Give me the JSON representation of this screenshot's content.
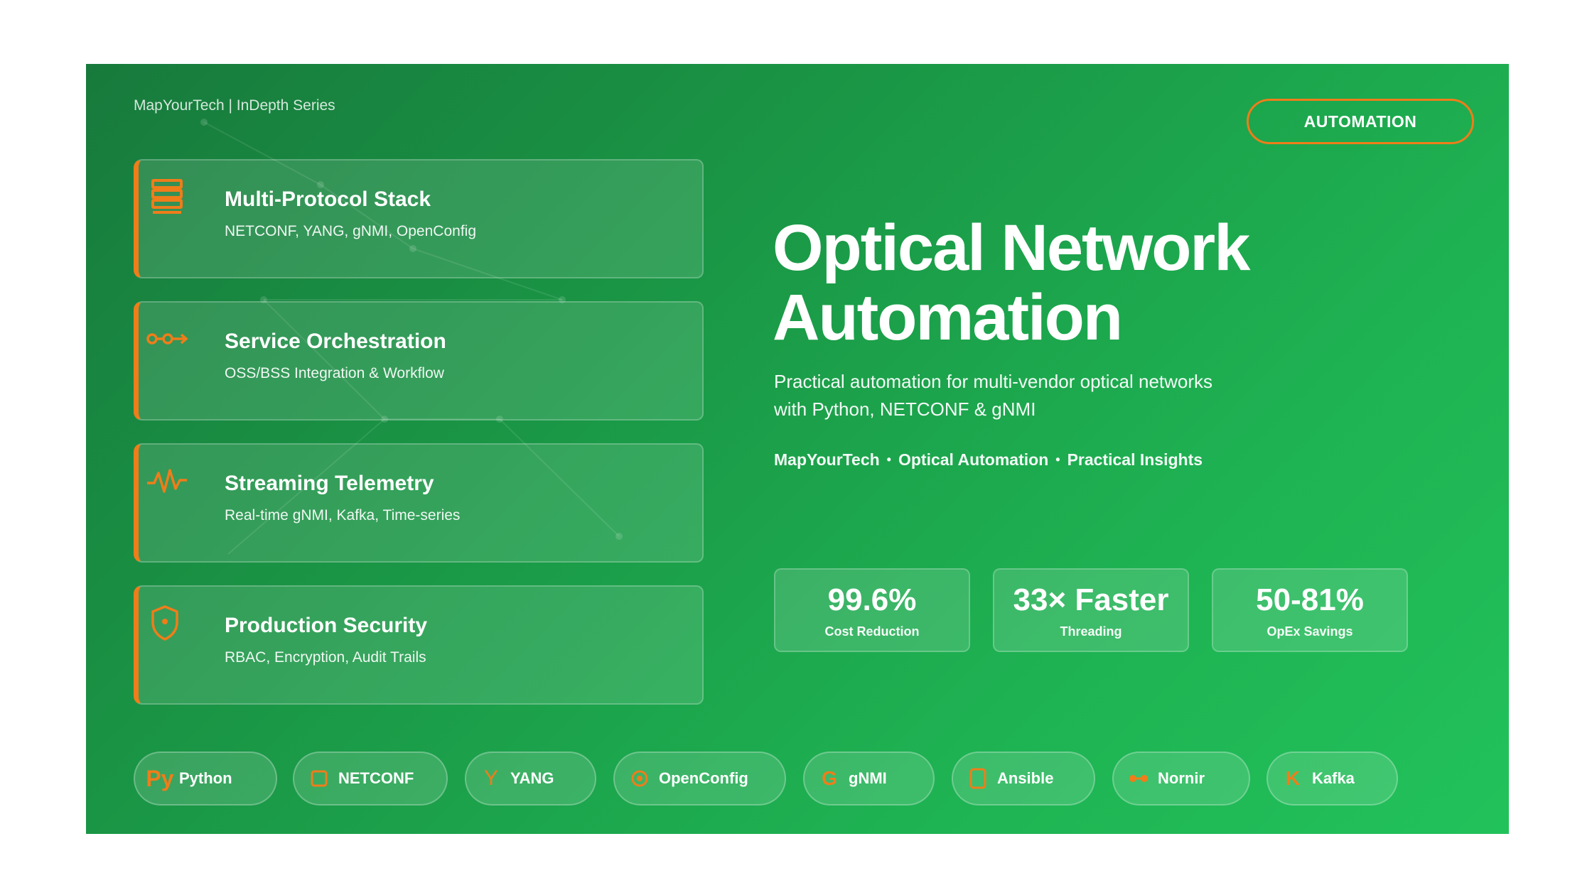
{
  "brand_top": "MapYourTech | InDepth Series",
  "badge": "AUTOMATION",
  "accent_color": "#ef7d1a",
  "background_gradient": [
    "#177a3c",
    "#22c25b"
  ],
  "cards": [
    {
      "title": "Multi-Protocol Stack",
      "subtitle": "NETCONF, YANG, gNMI, OpenConfig",
      "icon": "stack-icon"
    },
    {
      "title": "Service Orchestration",
      "subtitle": "OSS/BSS Integration & Workflow",
      "icon": "workflow-icon"
    },
    {
      "title": "Streaming Telemetry",
      "subtitle": "Real-time gNMI, Kafka, Time-series",
      "icon": "pulse-icon"
    },
    {
      "title": "Production Security",
      "subtitle": "RBAC, Encryption, Audit Trails",
      "icon": "shield-icon"
    }
  ],
  "hero": {
    "title_line1": "Optical Network",
    "title_line2": "Automation",
    "subtitle": "Practical automation for multi-vendor optical networks with Python, NETCONF & gNMI",
    "tagline": [
      "MapYourTech",
      "Optical Automation",
      "Practical Insights"
    ],
    "tagline_separator": "•"
  },
  "stats": [
    {
      "value": "99.6%",
      "label": "Cost Reduction"
    },
    {
      "value": "33× Faster",
      "label": "Threading"
    },
    {
      "value": "50-81%",
      "label": "OpEx Savings"
    }
  ],
  "tech": [
    {
      "label": "Python",
      "icon": "python-icon",
      "glyph": "Py"
    },
    {
      "label": "NETCONF",
      "icon": "square-icon",
      "glyph": ""
    },
    {
      "label": "YANG",
      "icon": "y-icon",
      "glyph": "Y"
    },
    {
      "label": "OpenConfig",
      "icon": "gear-icon",
      "glyph": ""
    },
    {
      "label": "gNMI",
      "icon": "g-icon",
      "glyph": "G"
    },
    {
      "label": "Ansible",
      "icon": "tablet-icon",
      "glyph": ""
    },
    {
      "label": "Nornir",
      "icon": "link-icon",
      "glyph": ""
    },
    {
      "label": "Kafka",
      "icon": "k-icon",
      "glyph": "K"
    }
  ]
}
